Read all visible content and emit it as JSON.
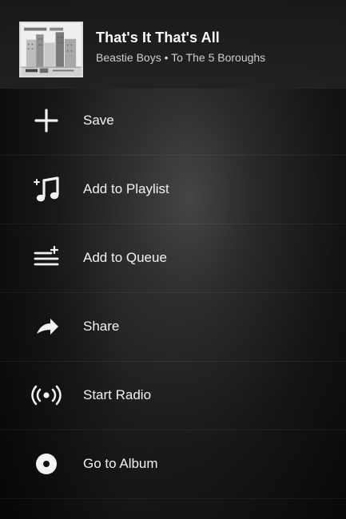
{
  "now_playing": {
    "title": "That's It That's All",
    "subtitle": "Beastie Boys • To The 5 Boroughs",
    "album_art_icon": "album-cover-city-skyline"
  },
  "menu": {
    "items": [
      {
        "label": "Save",
        "icon": "plus-icon"
      },
      {
        "label": "Add to Playlist",
        "icon": "playlist-add-icon"
      },
      {
        "label": "Add to Queue",
        "icon": "queue-add-icon"
      },
      {
        "label": "Share",
        "icon": "share-arrow-icon"
      },
      {
        "label": "Start Radio",
        "icon": "radio-icon"
      },
      {
        "label": "Go to Album",
        "icon": "album-disc-icon"
      }
    ]
  },
  "colors": {
    "text_primary": "#f4f4f4",
    "text_secondary": "#cfcfcf",
    "background_dark": "#0b0b0b",
    "divider": "#202020"
  }
}
